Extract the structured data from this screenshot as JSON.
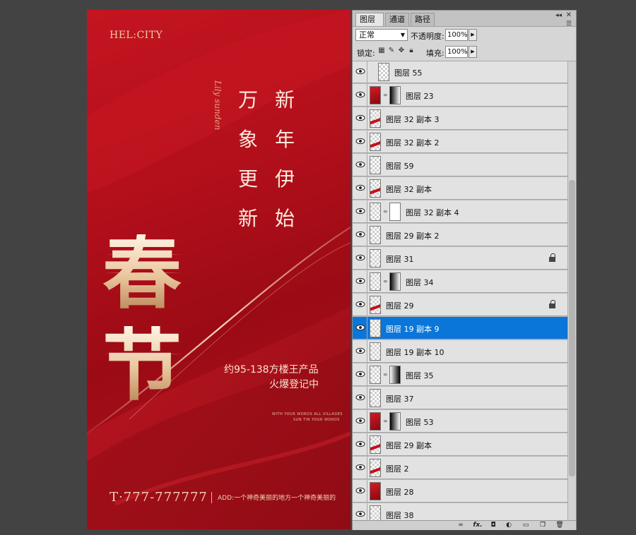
{
  "poster": {
    "logo": "HEL:CITY",
    "col1": [
      "万",
      "象",
      "更",
      "新"
    ],
    "col2": [
      "新",
      "年",
      "伊",
      "始"
    ],
    "script": "Lily sunden",
    "big_title_1": "春",
    "big_title_2": "节",
    "slogan_line1": "约95-138方楼王产品",
    "slogan_line2": "火爆登记中",
    "small_caption1": "WITH YOUR WORDS ALL VILLAGES",
    "small_caption2": "SUN TIN YOUR WORDS",
    "phone": "T·777-777777",
    "address": "ADD:一个神奇美丽的地方一个神奇美丽的"
  },
  "panel": {
    "tabs": [
      {
        "label": "图层",
        "close": "×"
      },
      {
        "label": "通道"
      },
      {
        "label": "路径"
      }
    ],
    "blend_mode": "正常",
    "opacity_label": "不透明度:",
    "opacity_value": "100%",
    "lock_label": "锁定:",
    "fill_label": "填充:",
    "fill_value": "100%",
    "layers": [
      {
        "name": "图层 55",
        "thumb": "checker",
        "mask": null,
        "locked": false,
        "selected": false
      },
      {
        "name": "图层 23",
        "thumb": "red",
        "mask": "grad-wb",
        "locked": false,
        "selected": false
      },
      {
        "name": "图层 32 副本 3",
        "thumb": "streak",
        "mask": null,
        "locked": false,
        "selected": false
      },
      {
        "name": "图层 32 副本 2",
        "thumb": "streak",
        "mask": null,
        "locked": false,
        "selected": false
      },
      {
        "name": "图层 59",
        "thumb": "checker",
        "mask": null,
        "locked": false,
        "selected": false
      },
      {
        "name": "图层 32 副本",
        "thumb": "streak",
        "mask": null,
        "locked": false,
        "selected": false
      },
      {
        "name": "图层 32 副本 4",
        "thumb": "checker",
        "mask": "white-dots",
        "locked": false,
        "selected": false
      },
      {
        "name": "图层 29 副本 2",
        "thumb": "checker",
        "mask": null,
        "locked": false,
        "selected": false
      },
      {
        "name": "图层 31",
        "thumb": "checker",
        "mask": null,
        "locked": true,
        "selected": false
      },
      {
        "name": "图层 34",
        "thumb": "checker",
        "mask": "grad-wb",
        "locked": false,
        "selected": false
      },
      {
        "name": "图层 29",
        "thumb": "streak",
        "mask": null,
        "locked": true,
        "selected": false
      },
      {
        "name": "图层 19 副本 9",
        "thumb": "checker",
        "mask": null,
        "locked": false,
        "selected": true
      },
      {
        "name": "图层 19 副本 10",
        "thumb": "checker",
        "mask": null,
        "locked": false,
        "selected": false
      },
      {
        "name": "图层 35",
        "thumb": "checker",
        "mask": "grad-bw",
        "locked": false,
        "selected": false
      },
      {
        "name": "图层 37",
        "thumb": "checker",
        "mask": null,
        "locked": false,
        "selected": false
      },
      {
        "name": "图层 53",
        "thumb": "red",
        "mask": "grad-wb",
        "locked": false,
        "selected": false
      },
      {
        "name": "图层 29 副本",
        "thumb": "streak",
        "mask": null,
        "locked": false,
        "selected": false
      },
      {
        "name": "图层 2",
        "thumb": "streak",
        "mask": null,
        "locked": false,
        "selected": false
      },
      {
        "name": "图层 28",
        "thumb": "red",
        "mask": null,
        "locked": false,
        "selected": false
      },
      {
        "name": "图层 38",
        "thumb": "checker",
        "mask": null,
        "locked": false,
        "selected": false
      }
    ],
    "footer_icons": [
      "link-icon",
      "fx-icon",
      "add-mask-icon",
      "adjustment-layer-icon",
      "new-group-icon",
      "new-layer-icon",
      "trash-icon"
    ],
    "footer_fx": "fx."
  },
  "colors": {
    "poster_red": "#b10f1a",
    "gold": "#e8c49c",
    "selection_blue": "#0a76d9",
    "workspace": "#434343"
  }
}
